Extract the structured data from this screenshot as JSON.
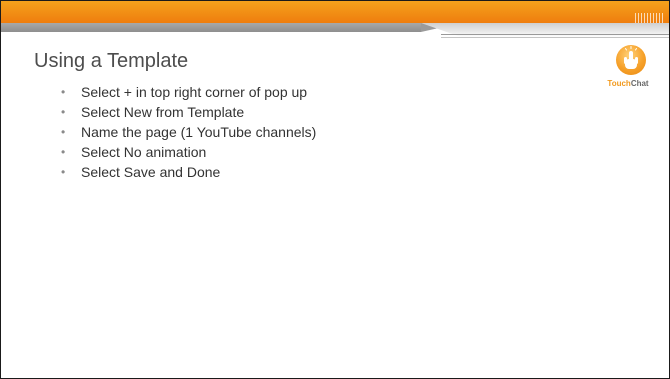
{
  "slide": {
    "title": "Using a Template",
    "bullets": [
      "Select  + in top right corner of pop up",
      "Select New from Template",
      "Name the page (1 YouTube channels)",
      "Select No animation",
      "Select Save and Done"
    ]
  },
  "logo": {
    "word_touch": "Touch",
    "word_chat": "Chat",
    "icon": "touchchat-hand-icon"
  },
  "colors": {
    "accent_orange": "#ef7d0e",
    "band_gray": "#9b9b9b",
    "title_text": "#4d4d4d",
    "body_text": "#333333"
  }
}
